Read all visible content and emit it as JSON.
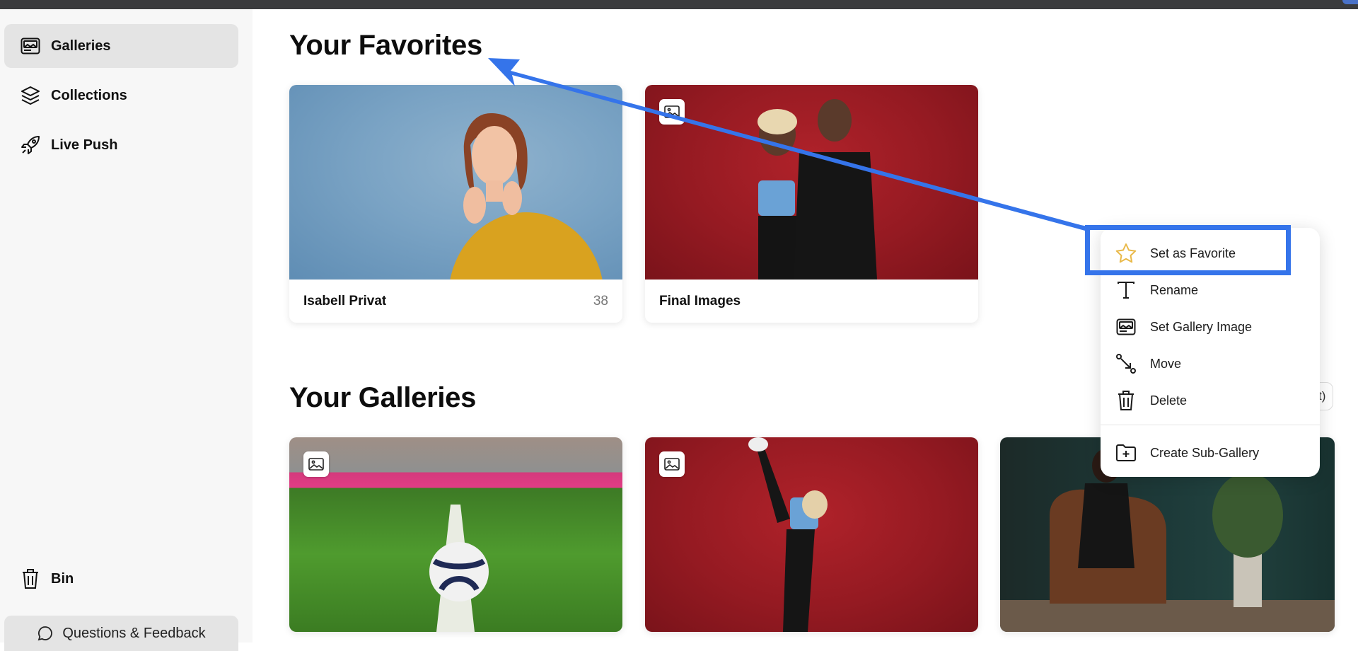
{
  "sidebar": {
    "items": [
      {
        "label": "Galleries",
        "icon": "gallery-icon"
      },
      {
        "label": "Collections",
        "icon": "layers-icon"
      },
      {
        "label": "Live Push",
        "icon": "rocket-icon"
      }
    ],
    "bin_label": "Bin",
    "feedback_label": "Questions & Feedback"
  },
  "favorites": {
    "title": "Your Favorites",
    "cards": [
      {
        "name": "Isabell Privat",
        "count": "38"
      },
      {
        "name": "Final Images",
        "count": ""
      }
    ]
  },
  "galleries": {
    "title": "Your Galleries",
    "partial_button_text": "t)"
  },
  "context_menu": {
    "items": [
      {
        "label": "Set as Favorite",
        "icon": "star-icon"
      },
      {
        "label": "Rename",
        "icon": "text-icon"
      },
      {
        "label": "Set Gallery Image",
        "icon": "gallery-image-icon"
      },
      {
        "label": "Move",
        "icon": "move-icon"
      },
      {
        "label": "Delete",
        "icon": "trash-icon"
      },
      {
        "label": "Create Sub-Gallery",
        "icon": "folder-plus-icon"
      }
    ]
  },
  "colors": {
    "annotation_blue": "#3574ea",
    "star_yellow": "#e9b949",
    "active_nav_bg": "#e4e4e4"
  }
}
